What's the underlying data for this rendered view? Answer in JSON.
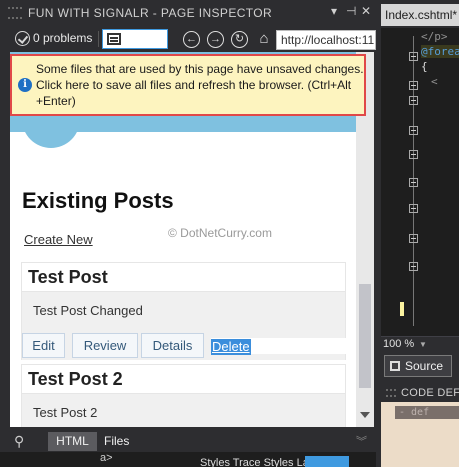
{
  "inspector": {
    "title": "FUN WITH SIGNALR - PAGE INSPECTOR",
    "controls": {
      "dropdown": "▾",
      "pin": "⊣",
      "close": "✕"
    },
    "problems": "0 problems",
    "url": "http://localhost:11",
    "nav_icons": [
      "select-element-icon",
      "back-icon",
      "forward-icon",
      "refresh-icon",
      "home-icon"
    ]
  },
  "notification": {
    "message": "Some files that are used by this page have unsaved changes. Click here to save all files and refresh the browser. (Ctrl+Alt +Enter)"
  },
  "page": {
    "heading": "Existing Posts",
    "create_new": "Create New",
    "watermark": "© DotNetCurry.com",
    "posts": [
      {
        "title": "Test Post",
        "body": "Test Post Changed",
        "actions": [
          "Edit",
          "Review",
          "Details",
          "Delete"
        ]
      },
      {
        "title": "Test Post 2",
        "body": "Test Post 2"
      }
    ]
  },
  "bottom": {
    "tabs": [
      "HTML",
      "Files"
    ],
    "strip_tag": "a>",
    "strip_text": "Styles  Trace Styles  Layout  Attr"
  },
  "editor": {
    "tab": "Index.cshtml*",
    "lines": [
      "</p>",
      "@foreach",
      "{",
      "<"
    ],
    "zoom": "100 %",
    "source_button": "Source",
    "code_def_title": "CODE DEFINITION",
    "code_def_line": "- def"
  },
  "colors": {
    "accent_blue": "#3f9ae0",
    "banner_blue": "#7fc1e0",
    "notice_bg": "#fdf4bf",
    "notice_border": "#e04848"
  }
}
